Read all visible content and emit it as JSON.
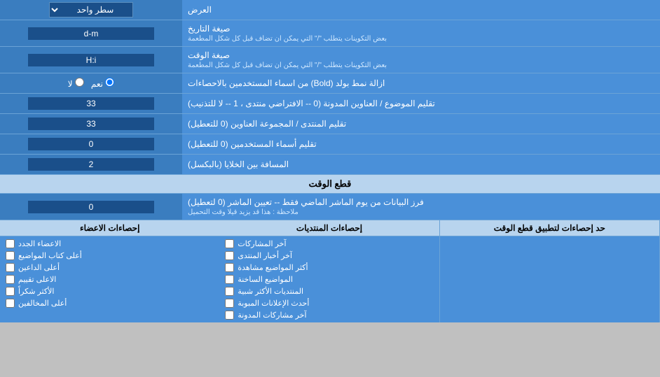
{
  "title": "العرض",
  "rows": [
    {
      "id": "display_mode",
      "label": "العرض",
      "input_type": "dropdown",
      "value": "سطر واحد"
    },
    {
      "id": "date_format",
      "label": "صيغة التاريخ",
      "sublabel": "بعض التكوينات يتطلب \"/\" التي يمكن ان تضاف قبل كل شكل المطعمة",
      "input_type": "text",
      "value": "d-m"
    },
    {
      "id": "time_format",
      "label": "صيغة الوقت",
      "sublabel": "بعض التكوينات يتطلب \"/\" التي يمكن ان تضاف قبل كل شكل المطعمة",
      "input_type": "text",
      "value": "H:i"
    },
    {
      "id": "remove_bold",
      "label": "ازالة نمط بولد (Bold) من اسماء المستخدمين بالاحصاءات",
      "input_type": "radio",
      "options": [
        "نعم",
        "لا"
      ],
      "selected": "نعم"
    },
    {
      "id": "trim_subject",
      "label": "تقليم الموضوع / العناوين المدونة (0 -- الافتراضي منتدى ، 1 -- لا للتذنيب)",
      "input_type": "text",
      "value": "33"
    },
    {
      "id": "trim_forum",
      "label": "تقليم المنتدى / المجموعة العناوين (0 للتعطيل)",
      "input_type": "text",
      "value": "33"
    },
    {
      "id": "trim_usernames",
      "label": "تقليم أسماء المستخدمين (0 للتعطيل)",
      "input_type": "text",
      "value": "0"
    },
    {
      "id": "cell_spacing",
      "label": "المسافة بين الخلايا (بالبكسل)",
      "input_type": "text",
      "value": "2"
    }
  ],
  "section_cutoff": {
    "title": "قطع الوقت"
  },
  "cutoff_row": {
    "id": "cutoff_days",
    "label": "فرز البيانات من يوم الماشر الماضي فقط -- تعيين الماشر (0 لتعطيل)",
    "sublabel": "ملاحظة : هذا قد يزيد قيلا وقت التحميل",
    "input_type": "text",
    "value": "0"
  },
  "stats_limit": {
    "label": "حد إحصاءات لتطبيق قطع الوقت"
  },
  "checkboxes": {
    "col1_header": "",
    "col2_header": "إحصاءات المنتديات",
    "col3_header": "إحصاءات الاعضاء",
    "col2_items": [
      "آخر المشاركات",
      "آخر أخبار المنتدى",
      "أكثر المواضيع مشاهدة",
      "المواضيع الساخنة",
      "المنتديات الأكثر شبية",
      "أحدث الإعلانات المبوبة",
      "آخر مشاركات المدونة"
    ],
    "col3_items": [
      "الاعضاء الجدد",
      "أعلى كتاب المواضيع",
      "أعلى الداعين",
      "الاعلى تقييم",
      "الأكثر شكراً",
      "أعلى المخالفين"
    ]
  }
}
